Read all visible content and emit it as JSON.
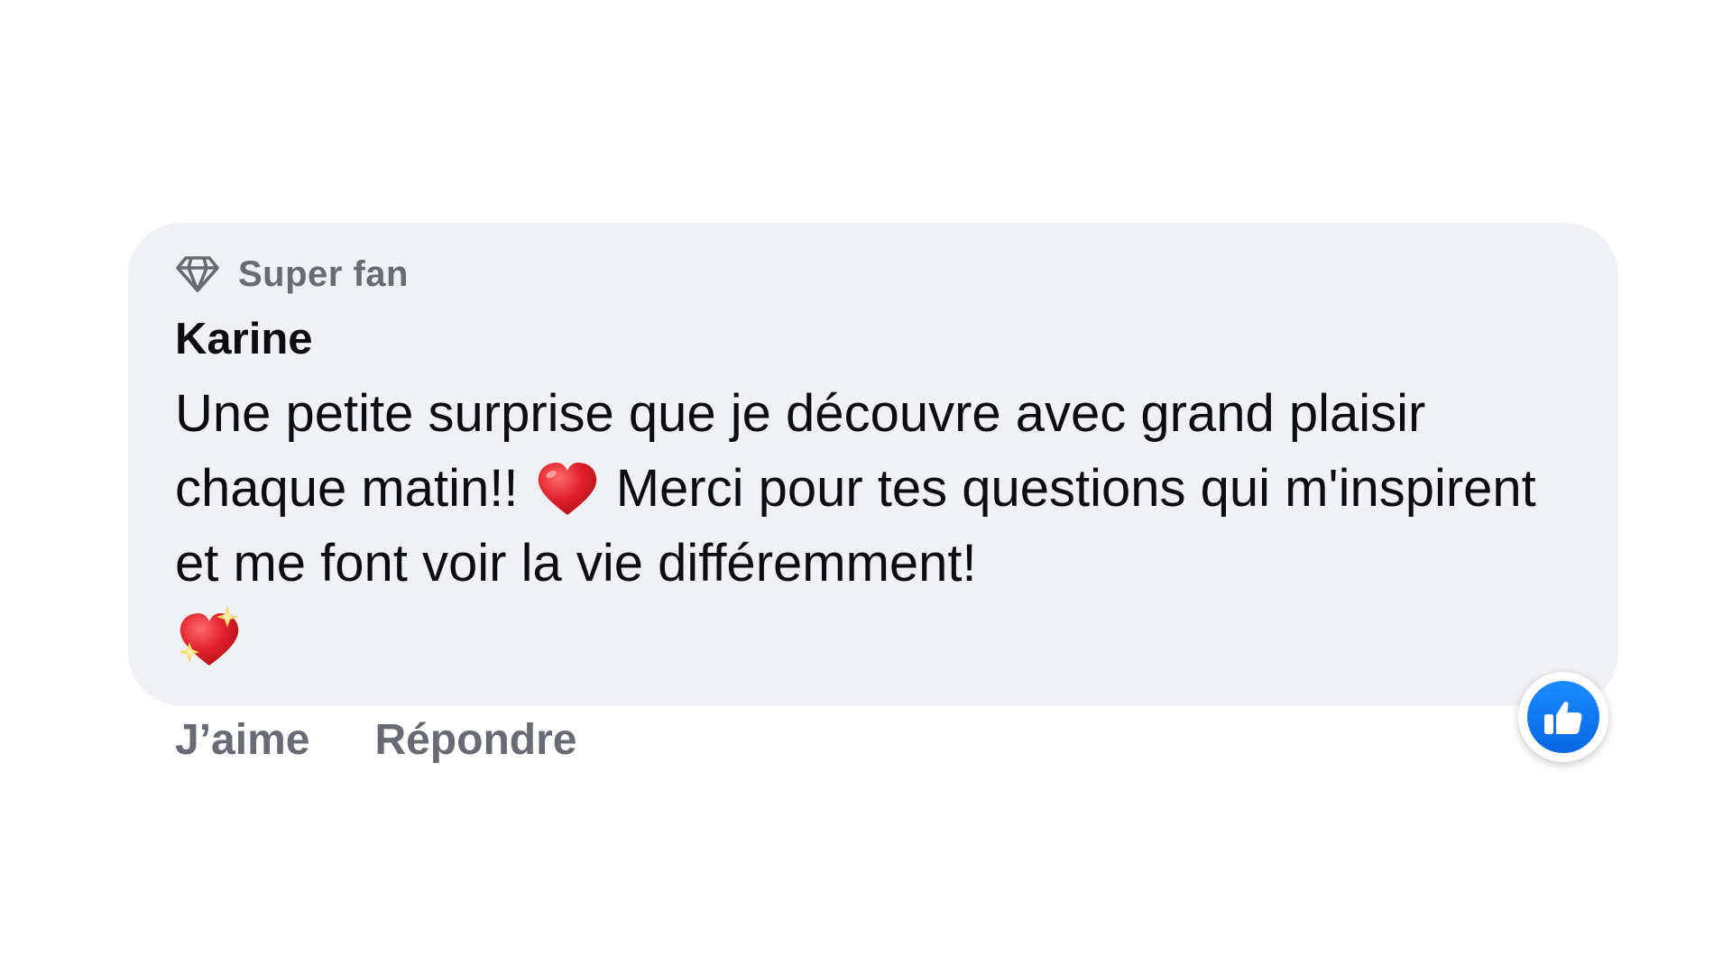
{
  "comment": {
    "badge": {
      "icon": "diamond-icon",
      "label": "Super fan"
    },
    "author": "Karine",
    "text_part1": "Une petite surprise que je découvre avec grand plaisir chaque matin!! ",
    "inline_emoji": "red-heart-emoji",
    "text_part2": " Merci pour tes questions qui m'inspirent et me font voir la vie différemment!",
    "trailing_emoji": "sparkling-heart-emoji"
  },
  "actions": {
    "like_label": "J’aime",
    "reply_label": "Répondre"
  },
  "reaction": {
    "icon": "thumbs-up-icon",
    "color": "#0866e3"
  },
  "colors": {
    "bubble_background": "#f0f1f4",
    "secondary_text": "#686b71",
    "primary_text": "#0d0d0f",
    "heart_red": "#e0202a"
  }
}
